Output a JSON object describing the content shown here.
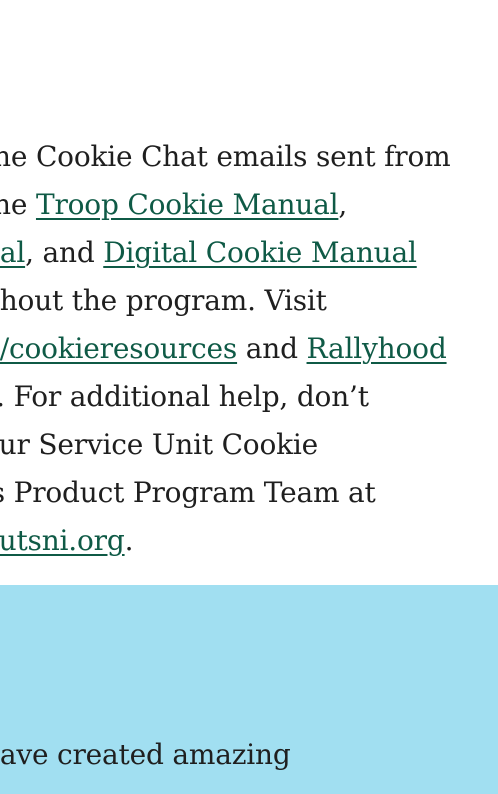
{
  "section_main": {
    "line1": "the Cookie Chat emails sent from",
    "line2_pre": "the ",
    "line2_link": "Troop Cookie Manual",
    "line2_post": ",",
    "line3_link1": "ual",
    "line3_mid": ", and ",
    "line3_link2": "Digital Cookie Manual",
    "line4": "ghout the program. Visit",
    "line5_link1": "g/cookieresources",
    "line5_mid": " and ",
    "line5_link2": "Rallyhood",
    "line6": "s. For additional help, don’t",
    "line7": "our Service Unit Cookie",
    "line8": "’s Product Program Team at",
    "line9_link": "outsni.org",
    "line9_post": "."
  },
  "section_blue": {
    "line1": "have created amazing"
  },
  "colors": {
    "link": "#0f5a46",
    "blue_background": "#a1dff1",
    "text": "#1f1f1f"
  }
}
